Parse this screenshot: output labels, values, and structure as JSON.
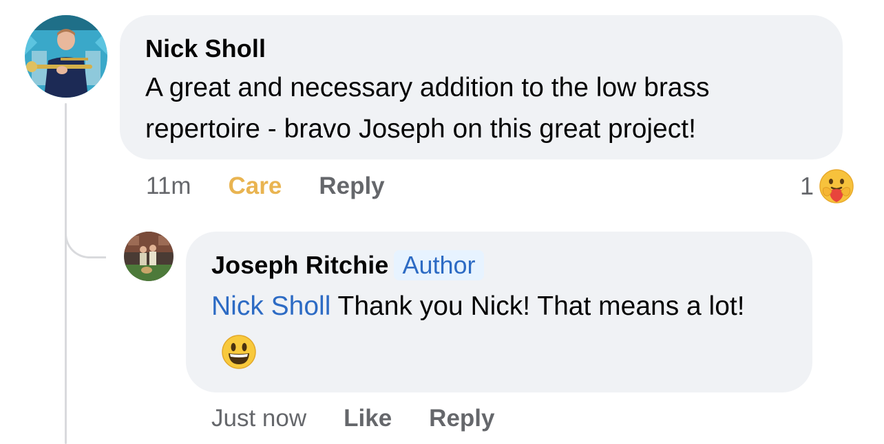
{
  "comments": [
    {
      "author": "Nick Sholl",
      "text": "A great and necessary addition to the low brass repertoire - bravo Joseph on this great project!",
      "time": "11m",
      "reaction_action": "Care",
      "reply_label": "Reply",
      "reaction_count": "1",
      "reaction_icon": "care-emoji-icon",
      "reaction_color": "#e9b451"
    }
  ],
  "reply": {
    "author": "Joseph Ritchie",
    "badge": "Author",
    "mention": "Nick Sholl",
    "text": "Thank you Nick! That means a lot!",
    "emoji": "grinning-face-emoji",
    "time": "Just now",
    "like_label": "Like",
    "reply_label": "Reply"
  },
  "colors": {
    "bubble_bg": "#f0f2f5",
    "link_blue": "#2d6bc4",
    "badge_bg": "#e7f3ff",
    "secondary_text": "#65676b",
    "care_yellow": "#e9b451"
  }
}
